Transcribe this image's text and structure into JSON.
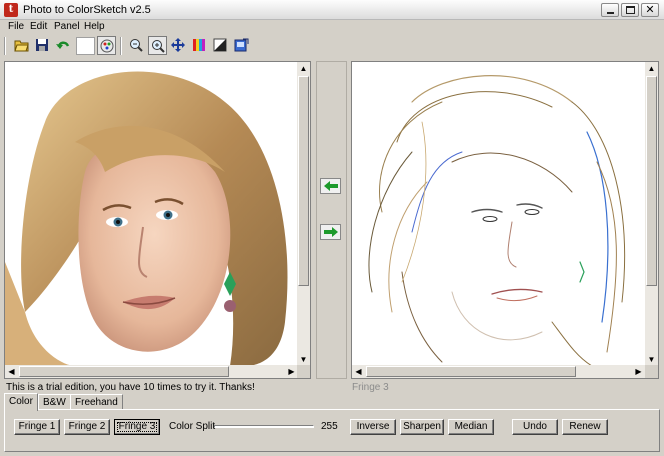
{
  "window": {
    "title": "Photo to ColorSketch v2.5",
    "app_icon_letter": "t"
  },
  "menu": [
    "File",
    "Edit",
    "Panel",
    "Help"
  ],
  "toolbar": {
    "icons": [
      "open-folder-icon",
      "save-icon",
      "undo-icon",
      "blank-slot",
      "palette-icon",
      "zoom-out-icon",
      "zoom-in-icon",
      "pan-icon",
      "color-bars-icon",
      "contrast-icon",
      "export-icon"
    ]
  },
  "status": {
    "trial_message": "This is a trial edition, you have 10 times to try it. Thanks!",
    "result_label": "Fringe 3"
  },
  "tabs": [
    "Color",
    "B&W",
    "Freehand"
  ],
  "active_tab": "Color",
  "controls": {
    "fringe1": "Fringe 1",
    "fringe2": "Fringe 2",
    "fringe3": "Fringe 3",
    "color_split_label": "Color Split",
    "color_split_value": "255",
    "inverse": "Inverse",
    "sharpen": "Sharpen",
    "median": "Median",
    "undo": "Undo",
    "renew": "Renew"
  },
  "colors": {
    "arrow_green": "#1d9a2c",
    "chrome": "#d4d0c8"
  }
}
